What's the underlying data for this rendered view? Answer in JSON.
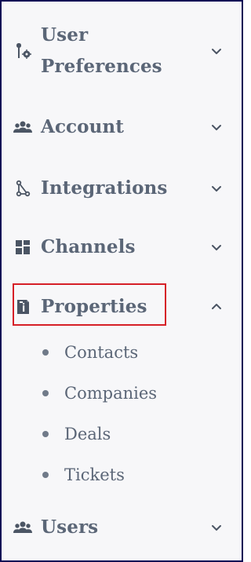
{
  "menu": {
    "items": [
      {
        "label_line1": "User",
        "label_line2": "Preferences",
        "icon": "tools-icon",
        "expanded": false
      },
      {
        "label": "Account",
        "icon": "users-icon",
        "expanded": false
      },
      {
        "label": "Integrations",
        "icon": "flow-icon",
        "expanded": false
      },
      {
        "label": "Channels",
        "icon": "grid-icon",
        "expanded": false
      },
      {
        "label": "Properties",
        "icon": "properties-icon",
        "expanded": true,
        "selected": true
      },
      {
        "label": "Users",
        "icon": "users-icon",
        "expanded": false
      }
    ],
    "properties_children": [
      "Contacts",
      "Companies",
      "Deals",
      "Tickets"
    ]
  },
  "theme": {
    "text": "#5b6677",
    "icon": "#4b5564",
    "border": "#0d0b55",
    "selection": "#d61f27",
    "background": "#f7f7f9"
  }
}
